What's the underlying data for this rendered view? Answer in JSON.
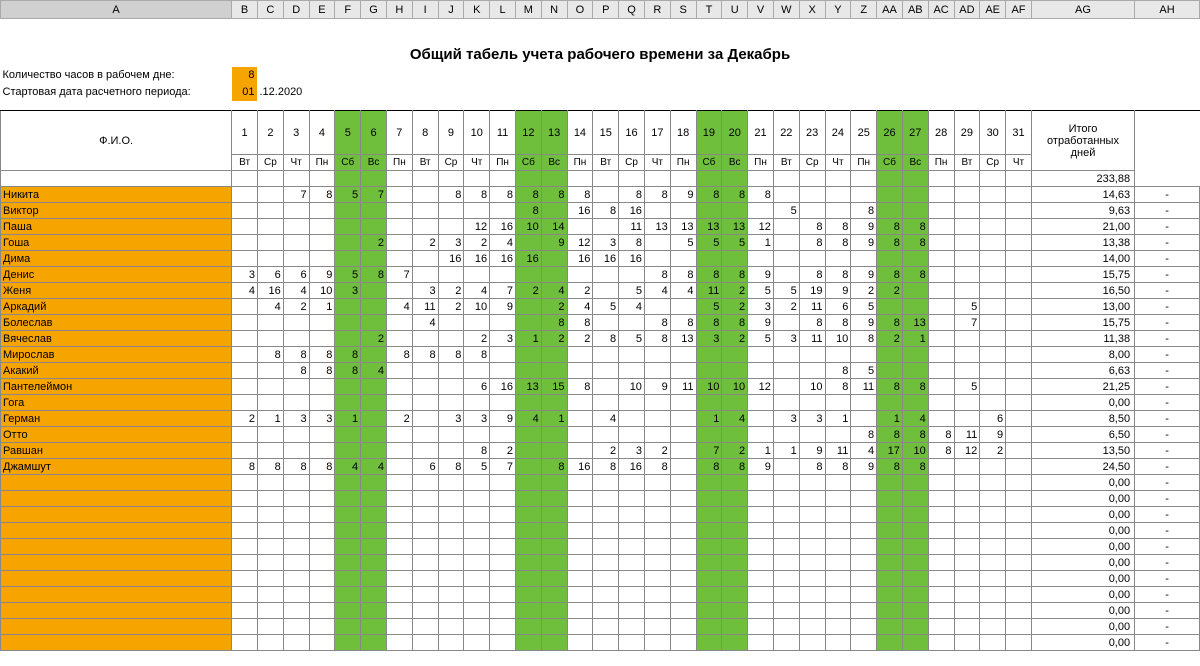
{
  "columns": [
    "A",
    "B",
    "C",
    "D",
    "E",
    "F",
    "G",
    "H",
    "I",
    "J",
    "K",
    "L",
    "M",
    "N",
    "O",
    "P",
    "Q",
    "R",
    "S",
    "T",
    "U",
    "V",
    "W",
    "X",
    "Y",
    "Z",
    "AA",
    "AB",
    "AC",
    "AD",
    "AE",
    "AF",
    "AG",
    "AH"
  ],
  "title": "Общий табель учета рабочего времени за Декабрь",
  "meta": {
    "hours_label": "Количество часов в рабочем дне:",
    "hours_value": "8",
    "start_label": "Стартовая дата расчетного периода:",
    "start_day": "01",
    "start_rest": ".12.2020"
  },
  "header": {
    "fio": "Ф.И.О.",
    "days": [
      "1",
      "2",
      "3",
      "4",
      "5",
      "6",
      "7",
      "8",
      "9",
      "10",
      "11",
      "12",
      "13",
      "14",
      "15",
      "16",
      "17",
      "18",
      "19",
      "20",
      "21",
      "22",
      "23",
      "24",
      "25",
      "26",
      "27",
      "28",
      "29",
      "30",
      "31"
    ],
    "dow": [
      "Вт",
      "Ср",
      "Чт",
      "Пн",
      "Сб",
      "Вс",
      "Пн",
      "Вт",
      "Ср",
      "Чт",
      "Пн",
      "Сб",
      "Вс",
      "Пн",
      "Вт",
      "Ср",
      "Чт",
      "Пн",
      "Сб",
      "Вс",
      "Пн",
      "Вт",
      "Ср",
      "Чт",
      "Пн",
      "Сб",
      "Вс",
      "Пн",
      "Вт",
      "Ср",
      "Чт"
    ],
    "total_label": "Итого отработанных дней",
    "weekend_idx": [
      4,
      5,
      11,
      12,
      18,
      19,
      25,
      26
    ],
    "hdr_sum": "233,88"
  },
  "rows": [
    {
      "name": "Никита",
      "c": [
        "",
        "",
        "7",
        "8",
        "5",
        "7",
        "",
        "",
        "8",
        "8",
        "8",
        "8",
        "8",
        "8",
        "",
        "8",
        "8",
        "9",
        "8",
        "8",
        "8",
        "",
        "",
        "",
        "",
        "",
        "",
        "",
        "",
        "",
        ""
      ],
      "tot": "14,63"
    },
    {
      "name": "Виктор",
      "c": [
        "",
        "",
        "",
        "",
        "",
        "",
        "",
        "",
        "",
        "",
        "",
        "8",
        "",
        "16",
        "8",
        "16",
        "",
        "",
        "",
        "",
        "",
        "5",
        "",
        "",
        "8",
        "",
        "",
        "",
        "",
        "",
        ""
      ],
      "tot": "9,63"
    },
    {
      "name": "Паша",
      "c": [
        "",
        "",
        "",
        "",
        "",
        "",
        "",
        "",
        "",
        "12",
        "16",
        "10",
        "14",
        "",
        "",
        "11",
        "13",
        "13",
        "13",
        "13",
        "12",
        "",
        "8",
        "8",
        "9",
        "8",
        "8",
        "",
        "",
        "",
        ""
      ],
      "tot": "21,00"
    },
    {
      "name": "Гоша",
      "c": [
        "",
        "",
        "",
        "",
        "",
        "2",
        "",
        "2",
        "3",
        "2",
        "4",
        "",
        "9",
        "12",
        "3",
        "8",
        "",
        "5",
        "5",
        "5",
        "1",
        "",
        "8",
        "8",
        "9",
        "8",
        "8",
        "",
        "",
        "",
        ""
      ],
      "tot": "13,38"
    },
    {
      "name": "Дима",
      "c": [
        "",
        "",
        "",
        "",
        "",
        "",
        "",
        "",
        "16",
        "16",
        "16",
        "16",
        "",
        "16",
        "16",
        "16",
        "",
        "",
        "",
        "",
        "",
        "",
        "",
        "",
        "",
        "",
        "",
        "",
        "",
        "",
        ""
      ],
      "tot": "14,00"
    },
    {
      "name": "Денис",
      "c": [
        "3",
        "6",
        "6",
        "9",
        "5",
        "8",
        "7",
        "",
        "",
        "",
        "",
        "",
        "",
        "",
        "",
        "",
        "8",
        "8",
        "8",
        "8",
        "9",
        "",
        "8",
        "8",
        "9",
        "8",
        "8",
        "",
        "",
        "",
        ""
      ],
      "tot": "15,75"
    },
    {
      "name": "Женя",
      "c": [
        "4",
        "16",
        "4",
        "10",
        "3",
        "",
        "",
        "3",
        "2",
        "4",
        "7",
        "2",
        "4",
        "2",
        "",
        "5",
        "4",
        "4",
        "11",
        "2",
        "5",
        "5",
        "19",
        "9",
        "2",
        "2",
        "",
        "",
        "",
        "",
        ""
      ],
      "tot": "16,50"
    },
    {
      "name": "Аркадий",
      "c": [
        "",
        "4",
        "2",
        "1",
        "",
        "",
        "4",
        "11",
        "2",
        "10",
        "9",
        "",
        "2",
        "4",
        "5",
        "4",
        "",
        "",
        "5",
        "2",
        "3",
        "2",
        "11",
        "6",
        "5",
        "",
        "",
        "",
        "5",
        "",
        ""
      ],
      "tot": "13,00"
    },
    {
      "name": "Болеслав",
      "c": [
        "",
        "",
        "",
        "",
        "",
        "",
        "",
        "4",
        "",
        "",
        "",
        "",
        "8",
        "8",
        "",
        "",
        "8",
        "8",
        "8",
        "8",
        "9",
        "",
        "8",
        "8",
        "9",
        "8",
        "13",
        "",
        "7",
        "",
        ""
      ],
      "tot": "15,75"
    },
    {
      "name": "Вячеслав",
      "c": [
        "",
        "",
        "",
        "",
        "",
        "2",
        "",
        "",
        "",
        "2",
        "3",
        "1",
        "2",
        "2",
        "8",
        "5",
        "8",
        "13",
        "3",
        "2",
        "5",
        "3",
        "11",
        "10",
        "8",
        "2",
        "1",
        "",
        "",
        "",
        ""
      ],
      "tot": "11,38"
    },
    {
      "name": "Мирослав",
      "c": [
        "",
        "8",
        "8",
        "8",
        "8",
        "",
        "8",
        "8",
        "8",
        "8",
        "",
        "",
        "",
        "",
        "",
        "",
        "",
        "",
        "",
        "",
        "",
        "",
        "",
        "",
        "",
        "",
        "",
        "",
        "",
        "",
        ""
      ],
      "tot": "8,00"
    },
    {
      "name": "Акакий",
      "c": [
        "",
        "",
        "8",
        "8",
        "8",
        "4",
        "",
        "",
        "",
        "",
        "",
        "",
        "",
        "",
        "",
        "",
        "",
        "",
        "",
        "",
        "",
        "",
        "",
        "8",
        "5",
        "",
        "",
        "",
        "",
        "",
        ""
      ],
      "tot": "6,63"
    },
    {
      "name": "Пантелеймон",
      "c": [
        "",
        "",
        "",
        "",
        "",
        "",
        "",
        "",
        "",
        "6",
        "16",
        "13",
        "15",
        "8",
        "",
        "10",
        "9",
        "11",
        "10",
        "10",
        "12",
        "",
        "10",
        "8",
        "11",
        "8",
        "8",
        "",
        "5",
        "",
        ""
      ],
      "tot": "21,25"
    },
    {
      "name": "Гога",
      "c": [
        "",
        "",
        "",
        "",
        "",
        "",
        "",
        "",
        "",
        "",
        "",
        "",
        "",
        "",
        "",
        "",
        "",
        "",
        "",
        "",
        "",
        "",
        "",
        "",
        "",
        "",
        "",
        "",
        "",
        "",
        ""
      ],
      "tot": "0,00"
    },
    {
      "name": "Герман",
      "c": [
        "2",
        "1",
        "3",
        "3",
        "1",
        "",
        "2",
        "",
        "3",
        "3",
        "9",
        "4",
        "1",
        "",
        "4",
        "",
        "",
        "",
        "1",
        "4",
        "",
        "3",
        "3",
        "1",
        "",
        "1",
        "4",
        "",
        "",
        "6",
        ""
      ],
      "tot": "8,50"
    },
    {
      "name": "Отто",
      "c": [
        "",
        "",
        "",
        "",
        "",
        "",
        "",
        "",
        "",
        "",
        "",
        "",
        "",
        "",
        "",
        "",
        "",
        "",
        "",
        "",
        "",
        "",
        "",
        "",
        "8",
        "8",
        "8",
        "8",
        "11",
        "9",
        ""
      ],
      "tot": "6,50"
    },
    {
      "name": "Равшан",
      "c": [
        "",
        "",
        "",
        "",
        "",
        "",
        "",
        "",
        "",
        "8",
        "2",
        "",
        "",
        "",
        "2",
        "3",
        "2",
        "",
        "7",
        "2",
        "1",
        "1",
        "9",
        "11",
        "4",
        "17",
        "10",
        "8",
        "12",
        "2",
        ""
      ],
      "tot": "13,50"
    },
    {
      "name": "Джамшут",
      "c": [
        "8",
        "8",
        "8",
        "8",
        "4",
        "4",
        "",
        "6",
        "8",
        "5",
        "7",
        "",
        "8",
        "16",
        "8",
        "16",
        "8",
        "",
        "8",
        "8",
        "9",
        "",
        "8",
        "8",
        "9",
        "8",
        "8",
        "",
        "",
        "",
        ""
      ],
      "tot": "24,50"
    }
  ],
  "empty_rows": 11,
  "empty_tot": "0,00",
  "dash": "-"
}
